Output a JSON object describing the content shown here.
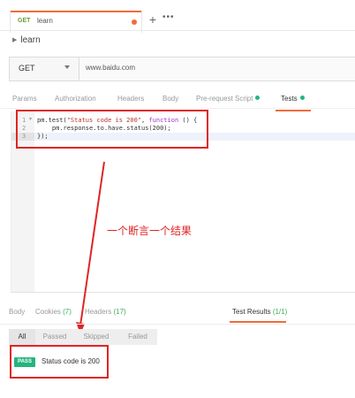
{
  "tab": {
    "method": "GET",
    "name": "learn"
  },
  "tabbar": {
    "plus": "+",
    "more": "•••"
  },
  "collection": {
    "name": "learn"
  },
  "request": {
    "method": "GET",
    "url": "www.baidu.com"
  },
  "request_tabs": [
    {
      "label": "Params"
    },
    {
      "label": "Authorization"
    },
    {
      "label": "Headers"
    },
    {
      "label": "Body"
    },
    {
      "label": "Pre-request Script"
    },
    {
      "label": "Tests"
    }
  ],
  "editor": {
    "line_numbers": [
      "1",
      "2",
      "3"
    ],
    "line1": {
      "a": "pm.test(",
      "b": "\"Status code is 200\"",
      "c": ", ",
      "d": "function",
      "e": " () {"
    },
    "line2": {
      "a": "    pm.response.to.have.status(200);"
    },
    "line3": {
      "a": "});"
    }
  },
  "annotation": {
    "text": "一个断言一个结果"
  },
  "response_tabs": [
    {
      "label": "Body"
    },
    {
      "label": "Cookies",
      "count": "(7)"
    },
    {
      "label": "Headers",
      "count": "(17)"
    },
    {
      "label": "Test Results",
      "count": "(1/1)"
    }
  ],
  "filters": [
    "All",
    "Passed",
    "Skipped",
    "Failed"
  ],
  "result": {
    "badge": "PASS",
    "text": "Status code is 200"
  },
  "colors": {
    "accent": "#f26b3a",
    "success": "#26b47f",
    "annotation": "#e02424"
  }
}
